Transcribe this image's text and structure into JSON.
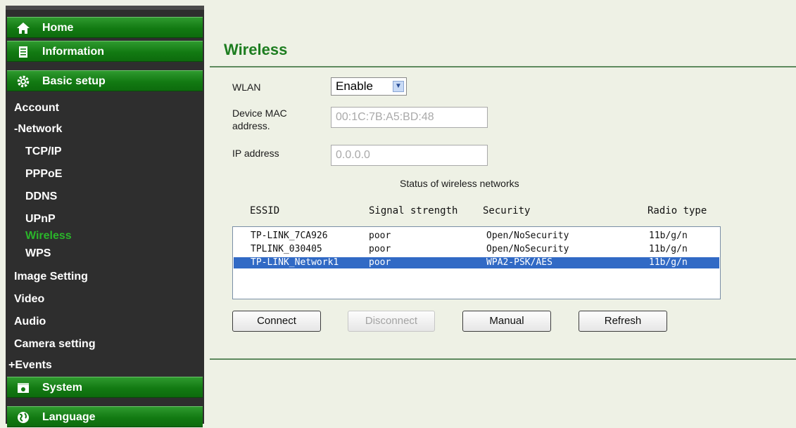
{
  "nav": {
    "home_label": "Home",
    "information_label": "Information",
    "basic_setup_label": "Basic setup",
    "items": [
      {
        "label": "Account"
      },
      {
        "label": "-Network"
      },
      {
        "label": "TCP/IP"
      },
      {
        "label": "PPPoE"
      },
      {
        "label": "DDNS"
      },
      {
        "label": "UPnP"
      },
      {
        "label": "Wireless"
      },
      {
        "label": "WPS"
      },
      {
        "label": "Image Setting"
      },
      {
        "label": "Video"
      },
      {
        "label": "Audio"
      },
      {
        "label": "Camera setting"
      },
      {
        "label": "+Events"
      }
    ],
    "system_label": "System",
    "language_label": "Language"
  },
  "page": {
    "title": "Wireless"
  },
  "form": {
    "wlan_label": "WLAN",
    "wlan_value": "Enable",
    "mac_label_line1": "Device MAC",
    "mac_label_line2": "address.",
    "mac_value": "00:1C:7B:A5:BD:48",
    "ip_label": "IP address",
    "ip_value": "0.0.0.0"
  },
  "networks": {
    "caption": "Status of wireless networks",
    "columns": [
      "ESSID",
      "Signal strength",
      "Security",
      "Radio type"
    ],
    "rows": [
      {
        "essid": "TP-LINK_7CA926",
        "signal": "poor",
        "security": "Open/NoSecurity",
        "radio": "11b/g/n"
      },
      {
        "essid": "TPLINK_030405",
        "signal": "poor",
        "security": "Open/NoSecurity",
        "radio": "11b/g/n"
      },
      {
        "essid": "TP-LINK_Network1",
        "signal": "poor",
        "security": "WPA2-PSK/AES",
        "radio": "11b/g/n"
      }
    ],
    "selected_index": 2
  },
  "buttons": {
    "connect": "Connect",
    "disconnect": "Disconnect",
    "manual": "Manual",
    "refresh": "Refresh"
  },
  "colors": {
    "accent_green": "#1d7d20",
    "active_nav": "#2ab52a",
    "selection": "#316ac5"
  }
}
